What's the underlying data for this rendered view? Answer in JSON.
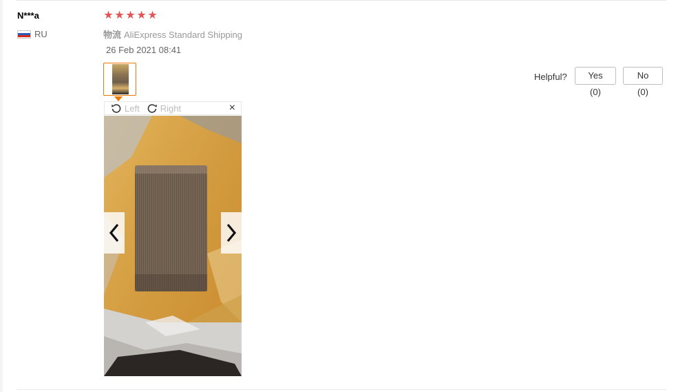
{
  "review": {
    "user_name": "N***a",
    "country_code": "RU",
    "rating": 5,
    "shipping_label": "物流",
    "shipping_method": "AliExpress Standard Shipping",
    "date": "26 Feb 2021 08:41"
  },
  "viewer": {
    "rotate_left_label": "Left",
    "rotate_right_label": "Right",
    "close_symbol": "×"
  },
  "helpful": {
    "label": "Helpful?",
    "yes_label": "Yes (0)",
    "no_label": "No (0)"
  },
  "colors": {
    "star": "#e55454",
    "thumb_border": "#f07800",
    "muted_text": "#999999"
  },
  "icons": [
    "flag-ru-icon",
    "star-icon",
    "rotate-left-icon",
    "rotate-right-icon",
    "close-icon",
    "chevron-left-icon",
    "chevron-right-icon"
  ]
}
